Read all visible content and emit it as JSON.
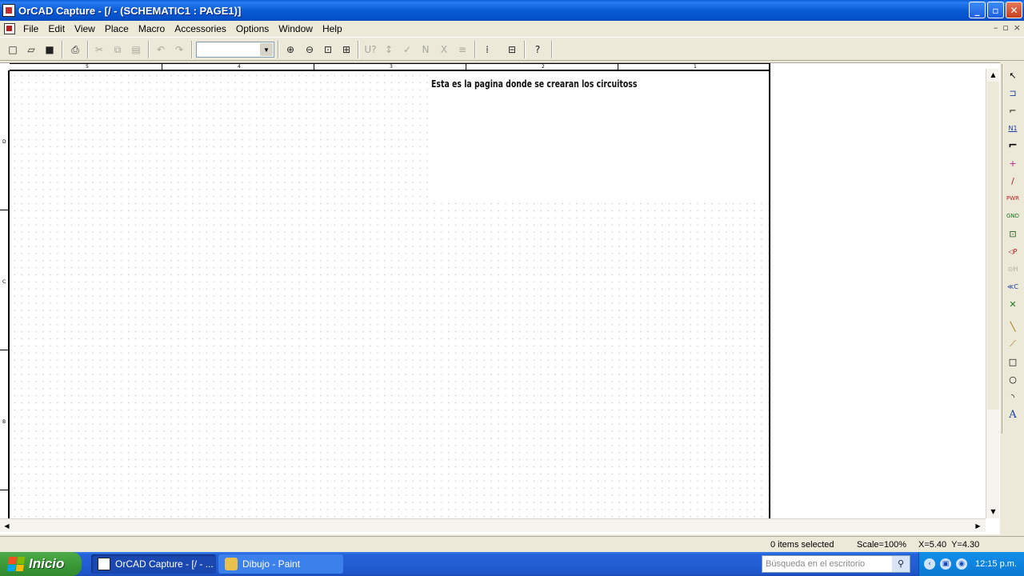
{
  "window": {
    "title": "OrCAD Capture - [/ - (SCHEMATIC1 : PAGE1)]",
    "minimize": "_",
    "maximize": "▫",
    "close": "✕"
  },
  "menu": {
    "items": [
      "File",
      "Edit",
      "View",
      "Place",
      "Macro",
      "Accessories",
      "Options",
      "Window",
      "Help"
    ],
    "mdi_minimize": "–",
    "mdi_restore": "▫",
    "mdi_close": "×"
  },
  "toolbar": {
    "combo_value": "",
    "tools": [
      {
        "name": "new-icon",
        "glyph": "□"
      },
      {
        "name": "open-icon",
        "glyph": "▱"
      },
      {
        "name": "save-icon",
        "glyph": "■"
      },
      {
        "name": "print-icon",
        "glyph": "⎙"
      },
      {
        "name": "cut-icon",
        "glyph": "✂"
      },
      {
        "name": "copy-icon",
        "glyph": "⧉"
      },
      {
        "name": "paste-icon",
        "glyph": "▤"
      },
      {
        "name": "undo-icon",
        "glyph": "↶"
      },
      {
        "name": "redo-icon",
        "glyph": "↷"
      },
      {
        "name": "zoom-in-icon",
        "glyph": "⊕"
      },
      {
        "name": "zoom-out-icon",
        "glyph": "⊖"
      },
      {
        "name": "zoom-area-icon",
        "glyph": "⊡"
      },
      {
        "name": "zoom-all-icon",
        "glyph": "⊞"
      },
      {
        "name": "annotate-icon",
        "glyph": "U?"
      },
      {
        "name": "back-annotate-icon",
        "glyph": "↕"
      },
      {
        "name": "drc-icon",
        "glyph": "✓"
      },
      {
        "name": "netlist-icon",
        "glyph": "N"
      },
      {
        "name": "cross-reference-icon",
        "glyph": "X"
      },
      {
        "name": "bom-icon",
        "glyph": "≡"
      },
      {
        "name": "snap-grid-icon",
        "glyph": "⁞"
      },
      {
        "name": "project-manager-icon",
        "glyph": "⊟"
      },
      {
        "name": "help-icon",
        "glyph": "?"
      }
    ]
  },
  "canvas": {
    "note": "Esta es la pagina donde se crearan los circuitoss",
    "ruler_top_labels": [
      "5",
      "4",
      "3",
      "2",
      "1"
    ],
    "ruler_left_labels": [
      "D",
      "C",
      "B"
    ]
  },
  "palette": {
    "tools": [
      {
        "name": "select-tool-icon",
        "glyph": "↖"
      },
      {
        "name": "place-part-icon",
        "glyph": "⊐"
      },
      {
        "name": "place-wire-icon",
        "glyph": "⌐"
      },
      {
        "name": "place-net-alias-icon",
        "glyph": "N1"
      },
      {
        "name": "place-bus-icon",
        "glyph": "⌐"
      },
      {
        "name": "place-junction-icon",
        "glyph": "+"
      },
      {
        "name": "place-bus-entry-icon",
        "glyph": "/"
      },
      {
        "name": "place-power-icon",
        "glyph": "PWR"
      },
      {
        "name": "place-ground-icon",
        "glyph": "GND"
      },
      {
        "name": "place-hierarchical-block-icon",
        "glyph": "⊡"
      },
      {
        "name": "place-hierarchical-port-icon",
        "glyph": "◁P"
      },
      {
        "name": "place-hierarchical-pin-icon",
        "glyph": "⊙H"
      },
      {
        "name": "place-off-page-connector-icon",
        "glyph": "≪C"
      },
      {
        "name": "place-no-connect-icon",
        "glyph": "✕"
      },
      {
        "name": "place-line-icon",
        "glyph": "╲"
      },
      {
        "name": "place-polyline-icon",
        "glyph": "⟋"
      },
      {
        "name": "place-rectangle-icon",
        "glyph": "□"
      },
      {
        "name": "place-ellipse-icon",
        "glyph": "○"
      },
      {
        "name": "place-arc-icon",
        "glyph": "◝"
      },
      {
        "name": "place-text-icon",
        "glyph": "A"
      }
    ]
  },
  "status": {
    "selection": "0 items selected",
    "scale": "Scale=100%",
    "coords": "X=5.40  Y=4.30"
  },
  "taskbar": {
    "start_label": "Inicio",
    "tasks": [
      {
        "label": "OrCAD Capture - [/ - ..."
      },
      {
        "label": "Dibujo - Paint"
      }
    ],
    "search_placeholder": "Búsqueda en el escritorio",
    "clock": "12:15 p.m."
  }
}
